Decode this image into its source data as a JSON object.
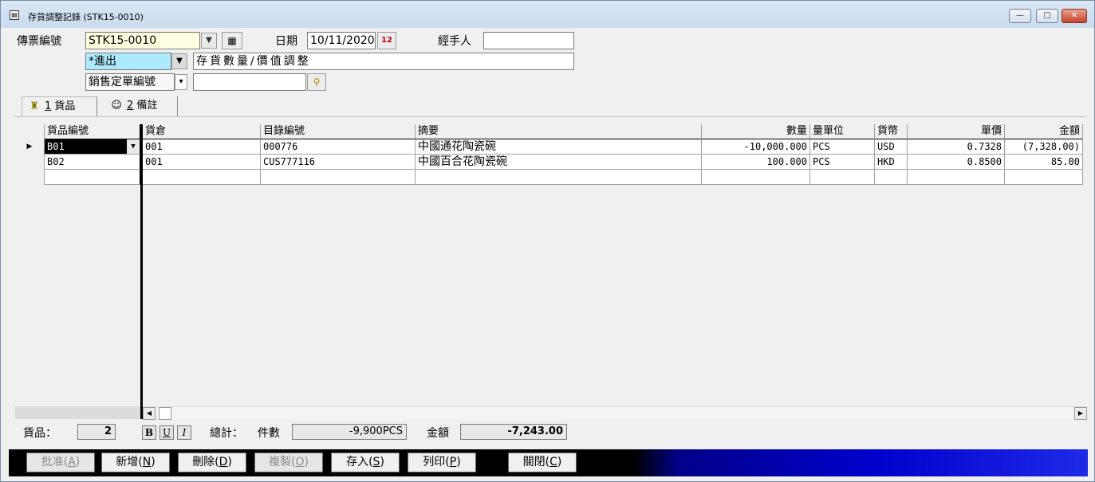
{
  "window": {
    "title": "存貨調整記錄 (STK15-0010)",
    "min_glyph": "—",
    "max_glyph": "□",
    "close_glyph": "✕"
  },
  "form": {
    "voucher_label": "傳票編號",
    "voucher_value": "STK15-0010",
    "date_label": "日期",
    "date_value": "10/11/2020",
    "handler_label": "經手人",
    "handler_value": "",
    "type_value": "*進出",
    "type_desc": "存貨數量/價值調整",
    "ref_type_value": "銷售定單編號",
    "ref_value": ""
  },
  "tabs": [
    {
      "num": "1",
      "label": "貨品"
    },
    {
      "num": "2",
      "label": "備註"
    }
  ],
  "grid": {
    "headers": [
      "貨品編號",
      "貨倉",
      "目錄編號",
      "摘要",
      "數量",
      "量單位",
      "貨幣",
      "單價",
      "金額"
    ],
    "rows": [
      [
        "B01",
        "001",
        "000776",
        "中國通花陶瓷碗",
        "-10,000.000",
        "PCS",
        "USD",
        "0.7328",
        "(7,328.00)"
      ],
      [
        "B02",
        "001",
        "CUS777116",
        "中國百合花陶瓷碗",
        "100.000",
        "PCS",
        "HKD",
        "0.8500",
        "85.00"
      ]
    ]
  },
  "summary": {
    "items_label": "貨品：",
    "items_value": "2",
    "bold_label": "B",
    "underline_label": "U",
    "italic_label": "I",
    "total_label": "總計：",
    "qty_label": "件數",
    "qty_value": "-9,900PCS",
    "amount_label": "金額",
    "amount_value": "-7,243.00"
  },
  "buttons": [
    {
      "label": "批准",
      "key": "A"
    },
    {
      "label": "新增",
      "key": "N"
    },
    {
      "label": "刪除",
      "key": "D"
    },
    {
      "label": "複製",
      "key": "O"
    },
    {
      "label": "存入",
      "key": "S"
    },
    {
      "label": "列印",
      "key": "P"
    },
    {
      "label": "關閉",
      "key": "C"
    }
  ]
}
